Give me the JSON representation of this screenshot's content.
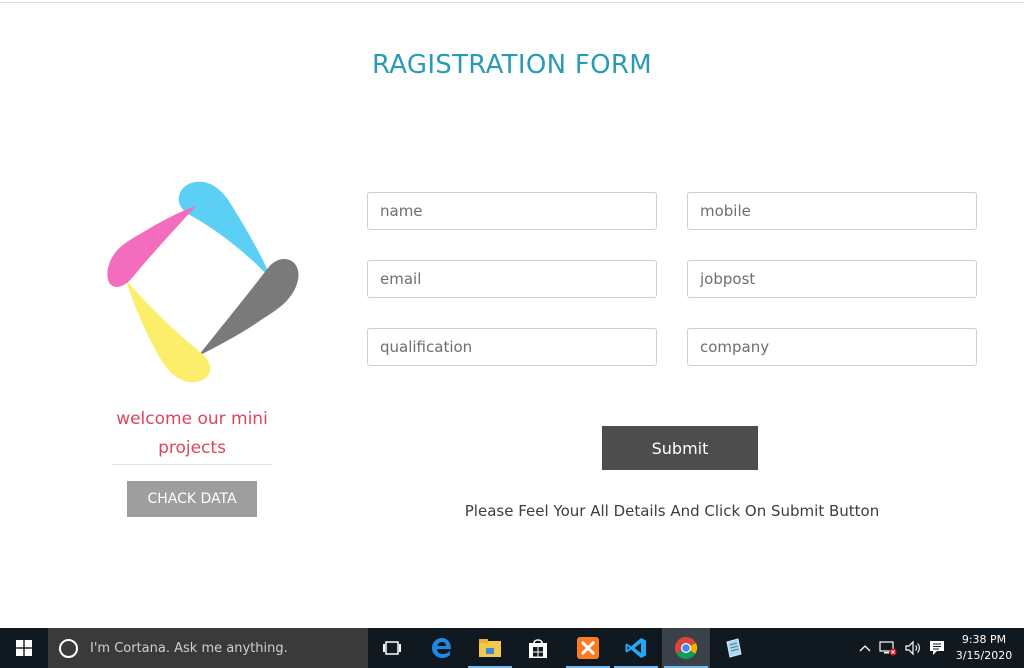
{
  "page": {
    "title": "RAGISTRATION FORM",
    "welcome": "welcome our mini projects",
    "check_button": "CHACK DATA",
    "submit_button": "Submit",
    "hint": "Please Feel Your All Details And Click On Submit Button"
  },
  "form": {
    "fields": [
      {
        "name": "name",
        "placeholder": "name",
        "value": ""
      },
      {
        "name": "mobile",
        "placeholder": "mobile",
        "value": ""
      },
      {
        "name": "email",
        "placeholder": "email",
        "value": ""
      },
      {
        "name": "jobpost",
        "placeholder": "jobpost",
        "value": ""
      },
      {
        "name": "qualification",
        "placeholder": "qualification",
        "value": ""
      },
      {
        "name": "company",
        "placeholder": "company",
        "value": ""
      }
    ]
  },
  "logo": {
    "petal_colors": [
      "#5ccff5",
      "#7a7a7a",
      "#fcee6a",
      "#f36cbd"
    ]
  },
  "colors": {
    "title": "#2a9bb5",
    "welcome": "#e0445c",
    "submit_bg": "#4d4d4d",
    "check_bg": "#9e9e9e"
  },
  "taskbar": {
    "search_placeholder": "I'm Cortana. Ask me anything.",
    "time": "9:38 PM",
    "date": "3/15/2020",
    "apps": [
      {
        "icon": "task-view-icon"
      },
      {
        "icon": "edge-icon"
      },
      {
        "icon": "file-explorer-icon"
      },
      {
        "icon": "store-icon"
      },
      {
        "icon": "xampp-icon"
      },
      {
        "icon": "vscode-icon"
      },
      {
        "icon": "chrome-icon"
      },
      {
        "icon": "notepad-icon"
      }
    ]
  }
}
